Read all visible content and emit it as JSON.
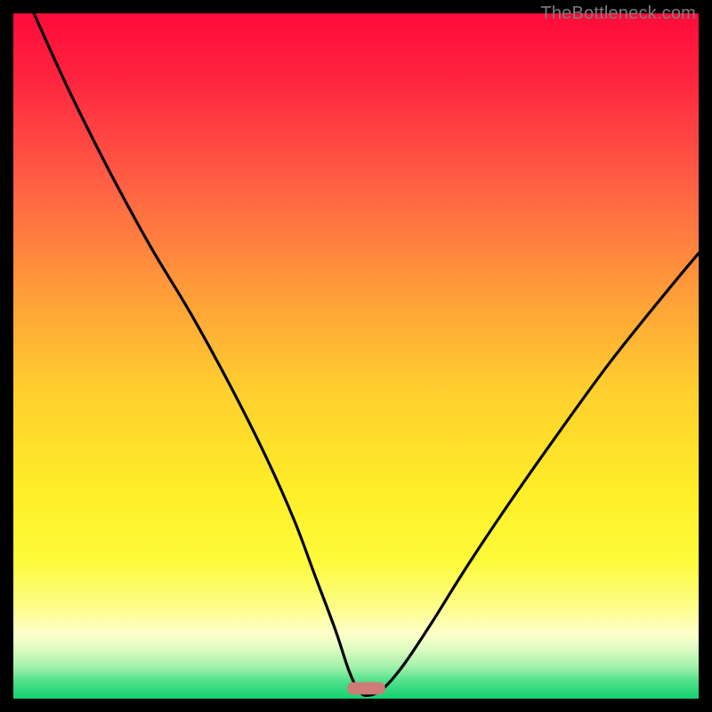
{
  "watermark": "TheBottleneck.com",
  "gradient_stops": [
    {
      "offset": 0.0,
      "color": "#ff0a3a"
    },
    {
      "offset": 0.1,
      "color": "#ff2640"
    },
    {
      "offset": 0.25,
      "color": "#ff6044"
    },
    {
      "offset": 0.4,
      "color": "#ff9a3a"
    },
    {
      "offset": 0.55,
      "color": "#ffcf2e"
    },
    {
      "offset": 0.7,
      "color": "#ffee28"
    },
    {
      "offset": 0.8,
      "color": "#fdfb3a"
    },
    {
      "offset": 0.865,
      "color": "#fdfd88"
    },
    {
      "offset": 0.905,
      "color": "#feffca"
    },
    {
      "offset": 0.93,
      "color": "#d9fbc0"
    },
    {
      "offset": 0.955,
      "color": "#9cf0a8"
    },
    {
      "offset": 0.975,
      "color": "#4fe089"
    },
    {
      "offset": 1.0,
      "color": "#14d171"
    }
  ],
  "marker": {
    "x_frac": 0.515,
    "y_frac": 0.985,
    "width_frac": 0.055,
    "height_frac": 0.018,
    "rx": 6,
    "fill": "#cf7b78"
  },
  "chart_data": {
    "type": "line",
    "title": "",
    "xlabel": "",
    "ylabel": "",
    "xlim": [
      0,
      100
    ],
    "ylim": [
      0,
      100
    ],
    "note": "Bottleneck-style V curve; y is mismatch %, minimum ~0 at x≈51, rising toward both ends. Values visually estimated from the plotted curve (no axis ticks shown).",
    "series": [
      {
        "name": "bottleneck-curve",
        "x": [
          3,
          8,
          14,
          20,
          26,
          32,
          37,
          41,
          44,
          47,
          49,
          50.5,
          52,
          54,
          57,
          61,
          66,
          72,
          79,
          87,
          95,
          100
        ],
        "y": [
          100,
          89,
          77,
          66,
          56,
          45,
          35,
          26,
          18,
          10,
          4,
          1,
          0.5,
          1.5,
          5,
          11,
          19,
          28,
          38,
          49,
          59,
          65
        ]
      }
    ],
    "optimum_x": 51.5
  }
}
